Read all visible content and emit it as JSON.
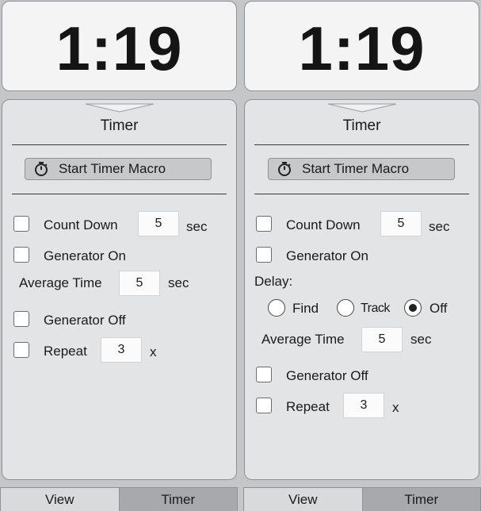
{
  "left": {
    "display": {
      "time": "1:19"
    },
    "panel": {
      "title": "Timer",
      "start_macro_label": "Start Timer Macro",
      "count_down": {
        "label": "Count Down",
        "value": "5",
        "unit": "sec",
        "checked": false
      },
      "generator_on": {
        "label": "Generator On",
        "checked": false
      },
      "average_time": {
        "label": "Average Time",
        "value": "5",
        "unit": "sec"
      },
      "generator_off": {
        "label": "Generator Off",
        "checked": false
      },
      "repeat": {
        "label": "Repeat",
        "value": "3",
        "unit": "x",
        "checked": false
      }
    },
    "tabs": {
      "view": "View",
      "timer": "Timer",
      "active": "timer"
    }
  },
  "right": {
    "display": {
      "time": "1:19"
    },
    "panel": {
      "title": "Timer",
      "start_macro_label": "Start Timer Macro",
      "count_down": {
        "label": "Count Down",
        "value": "5",
        "unit": "sec",
        "checked": false
      },
      "generator_on": {
        "label": "Generator On",
        "checked": false
      },
      "delay": {
        "label": "Delay:",
        "options": [
          "Find",
          "Track",
          "Off"
        ],
        "selected": "Off"
      },
      "average_time": {
        "label": "Average Time",
        "value": "5",
        "unit": "sec"
      },
      "generator_off": {
        "label": "Generator Off",
        "checked": false
      },
      "repeat": {
        "label": "Repeat",
        "value": "3",
        "unit": "x",
        "checked": false
      }
    },
    "tabs": {
      "view": "View",
      "timer": "Timer",
      "active": "timer"
    }
  }
}
